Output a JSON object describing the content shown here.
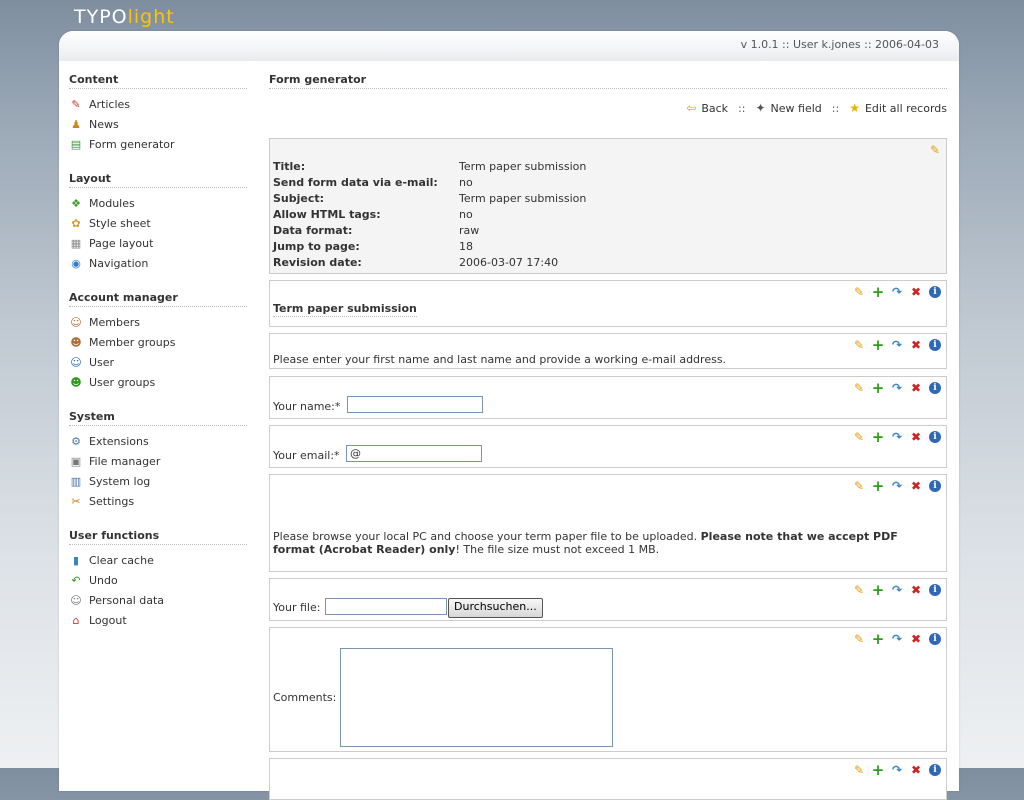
{
  "logo": {
    "part1": "TYPO",
    "part2": "light"
  },
  "header": {
    "version": "v 1.0.1 :: User k.jones :: 2006-04-03"
  },
  "sidebar": [
    {
      "title": "Content",
      "items": [
        {
          "label": "Articles",
          "icon": "pencil-icon"
        },
        {
          "label": "News",
          "icon": "news-icon"
        },
        {
          "label": "Form generator",
          "icon": "form-icon"
        }
      ]
    },
    {
      "title": "Layout",
      "items": [
        {
          "label": "Modules",
          "icon": "modules-icon"
        },
        {
          "label": "Style sheet",
          "icon": "palette-icon"
        },
        {
          "label": "Page layout",
          "icon": "layout-icon"
        },
        {
          "label": "Navigation",
          "icon": "globe-icon"
        }
      ]
    },
    {
      "title": "Account manager",
      "items": [
        {
          "label": "Members",
          "icon": "member-icon"
        },
        {
          "label": "Member groups",
          "icon": "member-groups-icon"
        },
        {
          "label": "User",
          "icon": "user-icon"
        },
        {
          "label": "User groups",
          "icon": "user-groups-icon"
        }
      ]
    },
    {
      "title": "System",
      "items": [
        {
          "label": "Extensions",
          "icon": "extensions-icon"
        },
        {
          "label": "File manager",
          "icon": "file-manager-icon"
        },
        {
          "label": "System log",
          "icon": "log-icon"
        },
        {
          "label": "Settings",
          "icon": "wrench-icon"
        }
      ]
    },
    {
      "title": "User functions",
      "items": [
        {
          "label": "Clear cache",
          "icon": "database-icon"
        },
        {
          "label": "Undo",
          "icon": "undo-icon"
        },
        {
          "label": "Personal data",
          "icon": "personal-data-icon"
        },
        {
          "label": "Logout",
          "icon": "home-icon"
        }
      ]
    }
  ],
  "main": {
    "title": "Form generator",
    "actions": {
      "back": "Back",
      "new_field": "New field",
      "edit_all": "Edit all records",
      "separator": "::"
    },
    "meta": [
      {
        "key": "Title:",
        "value": "Term paper submission"
      },
      {
        "key": "Send form data via e-mail:",
        "value": "no"
      },
      {
        "key": "Subject:",
        "value": "Term paper submission"
      },
      {
        "key": "Allow HTML tags:",
        "value": "no"
      },
      {
        "key": "Data format:",
        "value": "raw"
      },
      {
        "key": "Jump to page:",
        "value": "18"
      },
      {
        "key": "Revision date:",
        "value": "2006-03-07 17:40"
      }
    ],
    "headline": "Term paper submission",
    "intro": "Please enter your first name and last name and provide a working e-mail address.",
    "name_label": "Your name:*",
    "name_value": "",
    "email_label": "Your email:*",
    "email_value": "@",
    "browse_text": {
      "pre": "Please browse your local PC and choose your term paper file to be uploaded. ",
      "bold": "Please note that we accept PDF format (Acrobat Reader) only",
      "post": "! The file size must not exceed 1 MB."
    },
    "file_label": "Your file:",
    "file_button": "Durchsuchen...",
    "comments_label": "Comments:"
  },
  "colors": {
    "accent": "#ffc400",
    "edit": "#e59c00",
    "add": "#2e9c1b",
    "delete": "#d32121",
    "info": "#2f68b8"
  }
}
